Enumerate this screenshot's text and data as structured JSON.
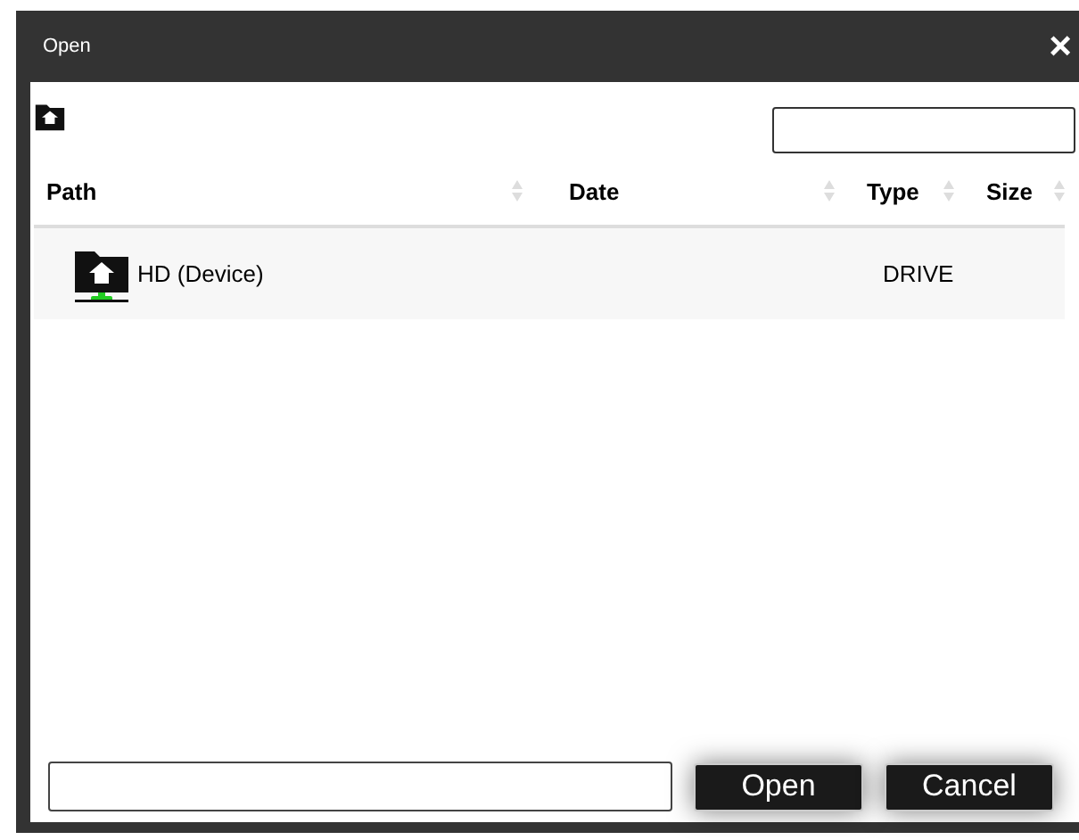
{
  "window": {
    "title": "Open",
    "close": "×"
  },
  "table": {
    "columns": [
      {
        "label": "Path"
      },
      {
        "label": "Date"
      },
      {
        "label": "Type"
      },
      {
        "label": "Size"
      }
    ],
    "rows": [
      {
        "path": "HD (Device)",
        "date": "",
        "type": "DRIVE",
        "size": "",
        "selected": false
      }
    ]
  },
  "buttons": [
    "Open",
    "Cancel"
  ]
}
